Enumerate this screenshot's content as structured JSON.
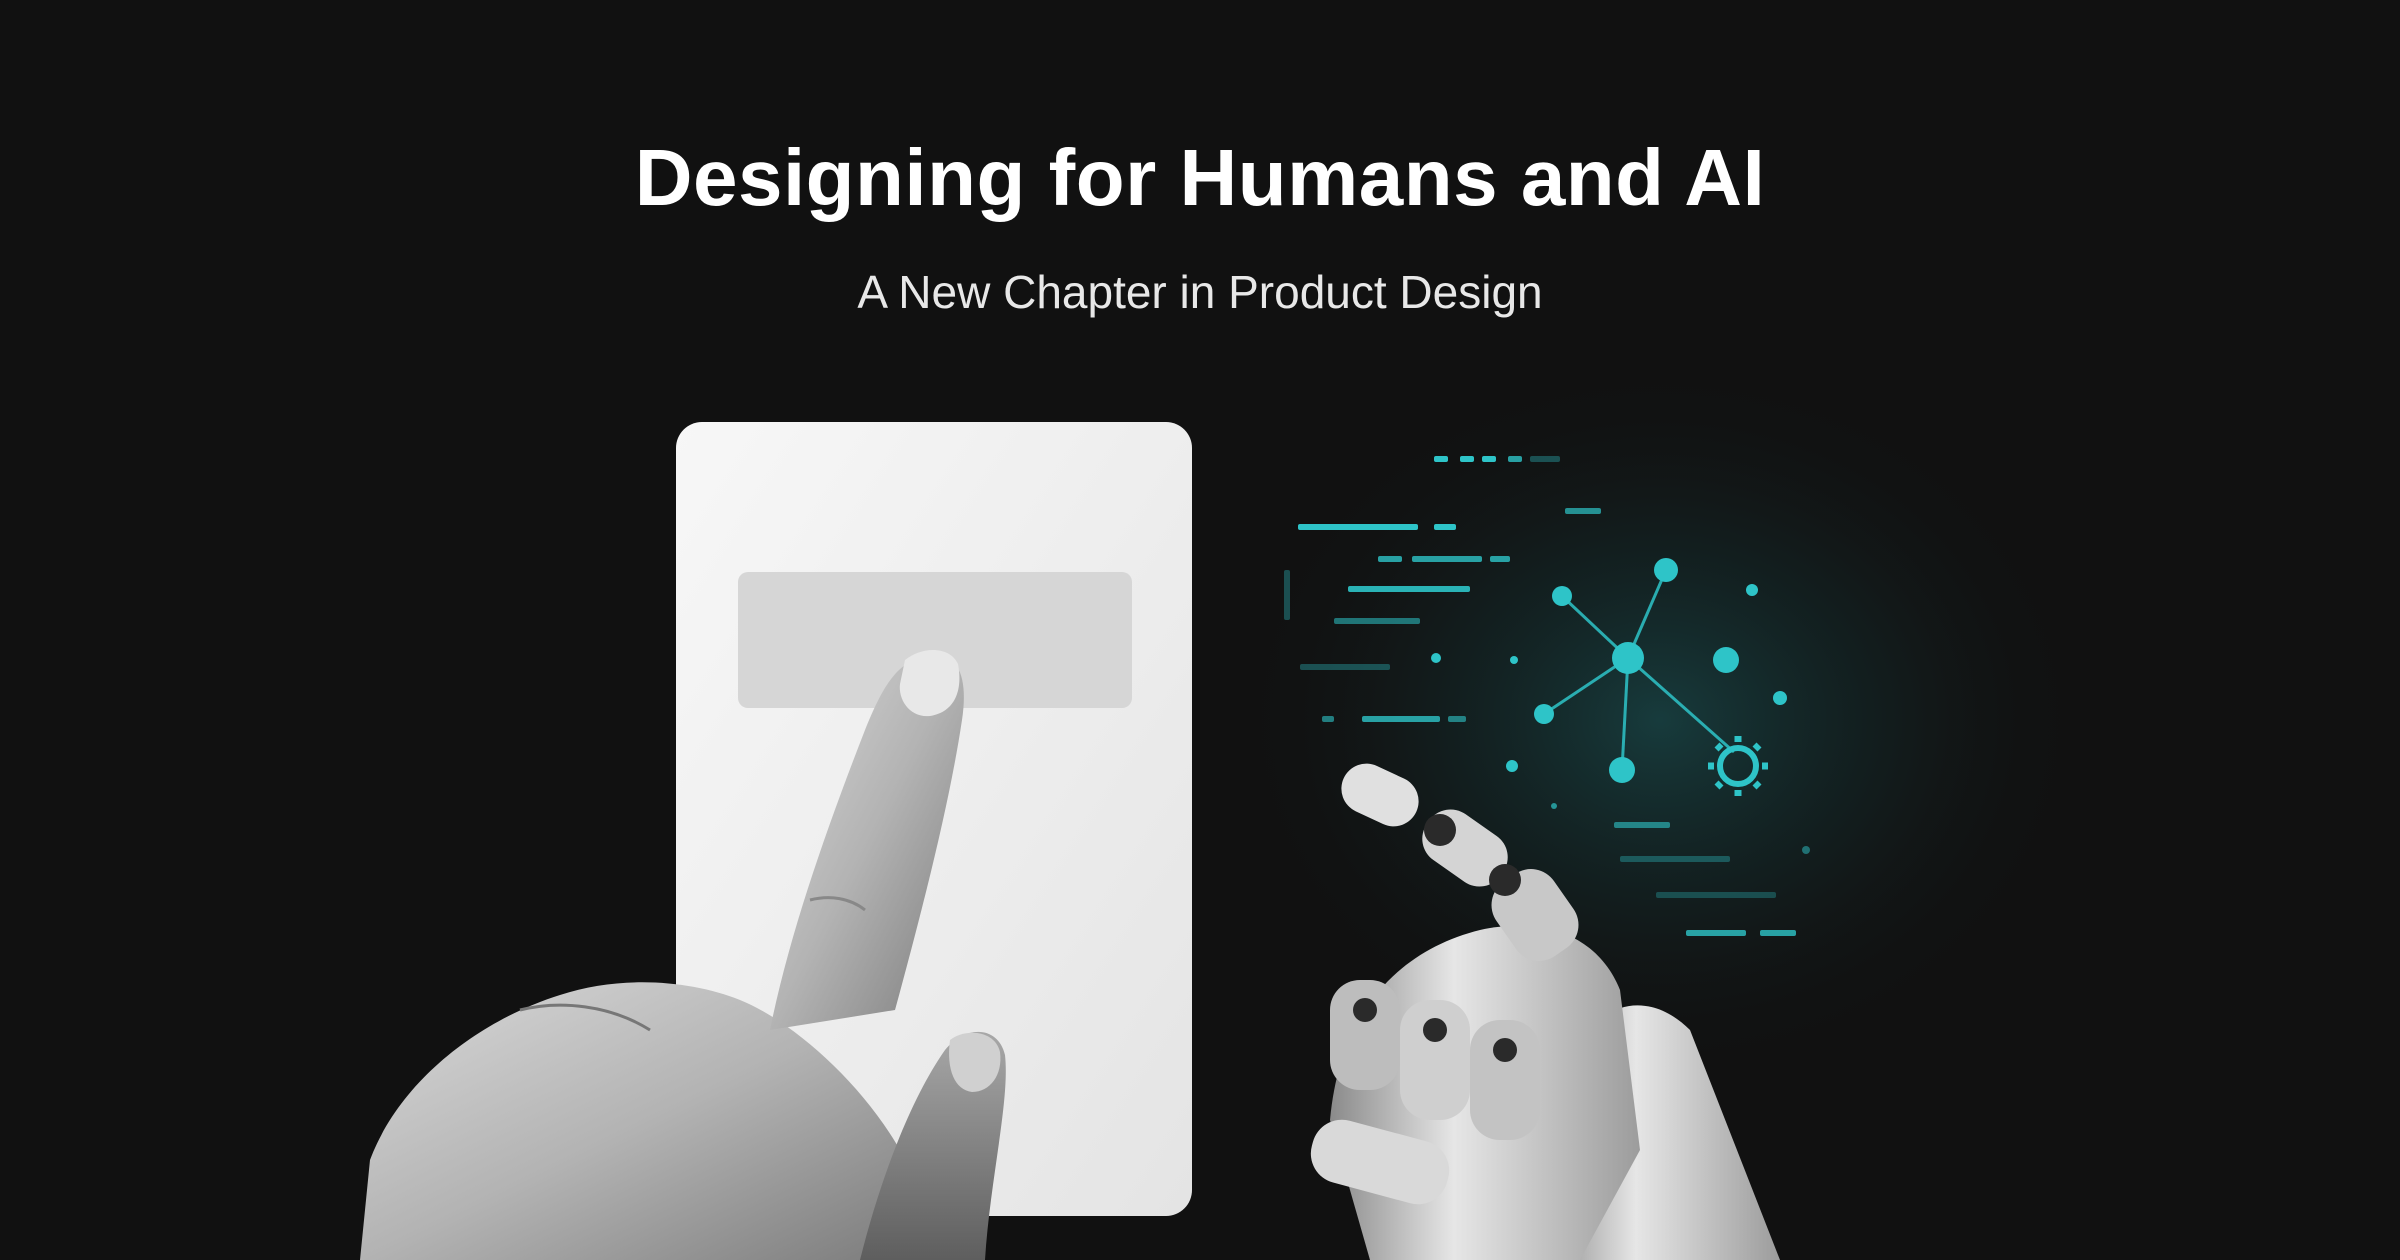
{
  "title": "Designing for Humans and AI",
  "subtitle": "A New Chapter in Product Design",
  "colors": {
    "background": "#111111",
    "text": "#ffffff",
    "accent": "#2ec4c8",
    "card": "#f2f2f2",
    "card_button": "#d6d6d6"
  },
  "icons": {
    "network": "network-graph-icon",
    "gear": "gear-icon"
  }
}
